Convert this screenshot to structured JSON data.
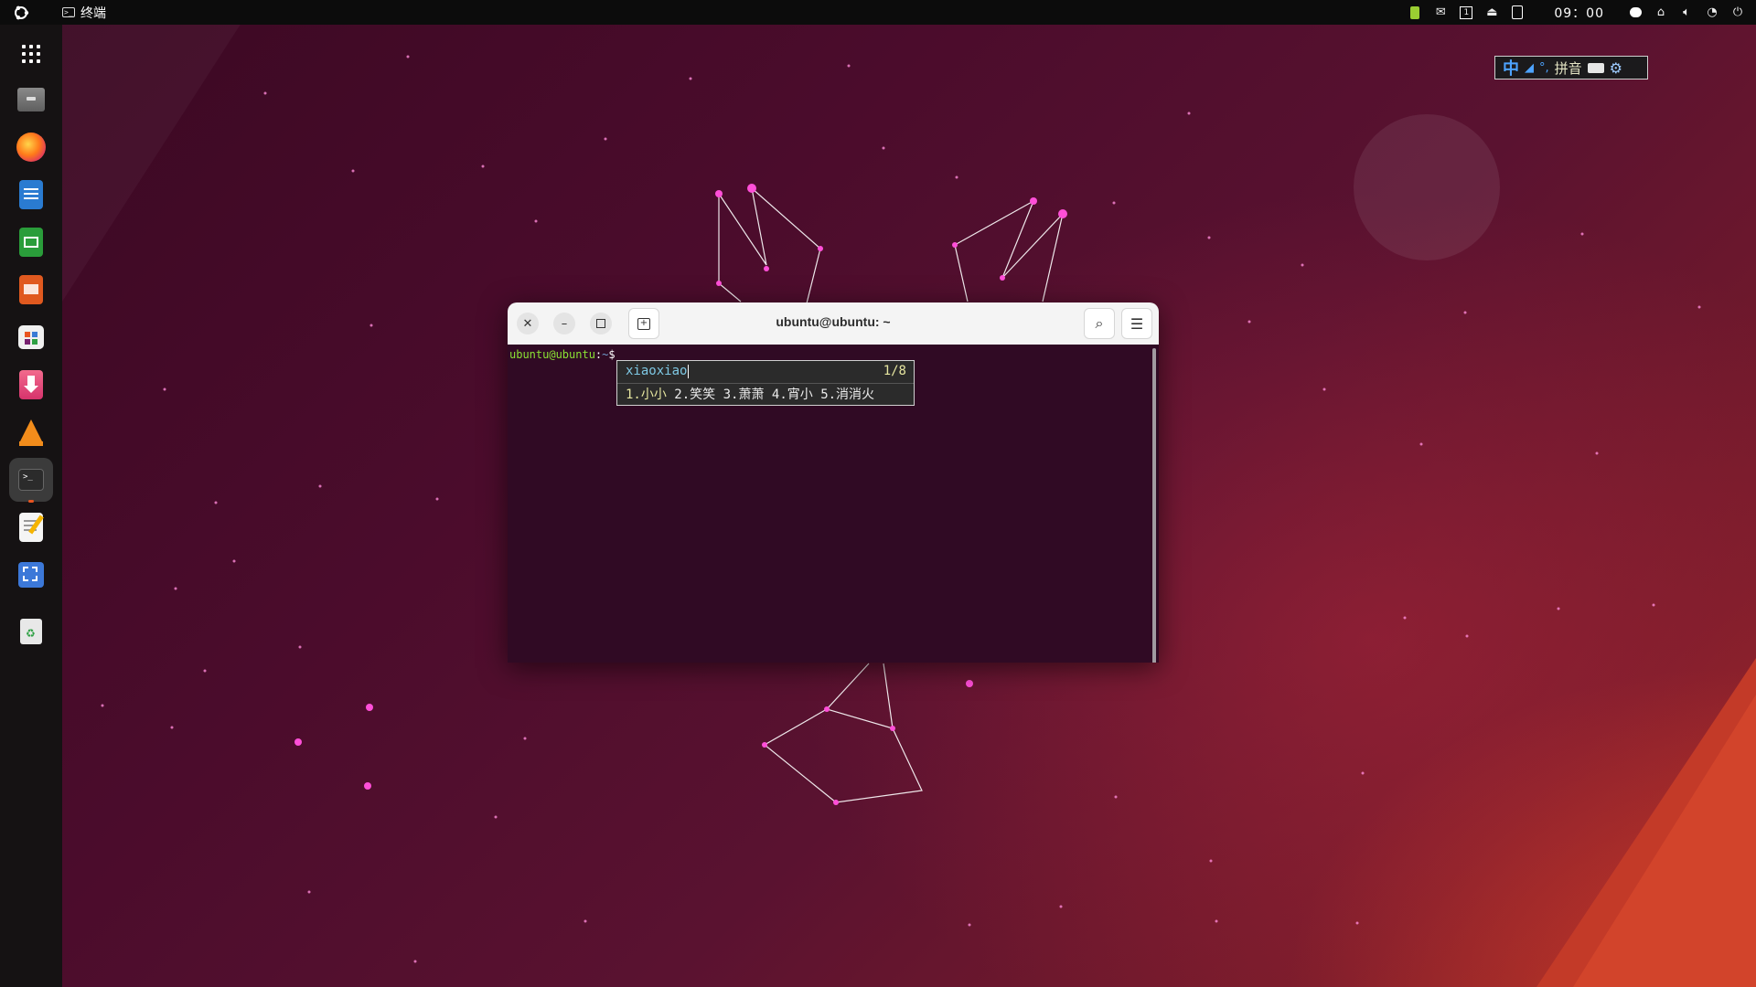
{
  "topbar": {
    "app_name": "终端",
    "clock": "09：00",
    "tray_icons": [
      "ime-icon",
      "mail-icon",
      "workspace-icon",
      "eject-icon",
      "clipboard-icon",
      "chat-icon",
      "network-icon",
      "volume-icon",
      "timer-icon",
      "power-icon"
    ]
  },
  "dock": {
    "items": [
      "apps-grid-icon",
      "files-icon",
      "firefox-icon",
      "writer-icon",
      "calc-icon",
      "impress-icon",
      "app-center-icon",
      "installer-icon",
      "vlc-icon",
      "terminal-icon",
      "text-editor-icon",
      "screenshot-icon",
      "trash-icon"
    ],
    "active": "terminal-icon"
  },
  "ime_toolbar": {
    "mode": "中",
    "pinyin_label": "拼音"
  },
  "terminal": {
    "title": "ubuntu@ubuntu: ~",
    "prompt_user": "ubuntu@ubuntu",
    "prompt_sep": ":",
    "prompt_path": "~",
    "prompt_symbol": "$"
  },
  "candidates": {
    "input": "xiaoxiao",
    "page": "1/8",
    "items": [
      "1.小小",
      "2.笑笑",
      "3.萧萧",
      "4.宵小",
      "5.消消火"
    ]
  },
  "colors": {
    "accent": "#e95420",
    "terminal_bg": "#300a24",
    "prompt_user": "#8ae234",
    "prompt_path": "#729fcf"
  }
}
